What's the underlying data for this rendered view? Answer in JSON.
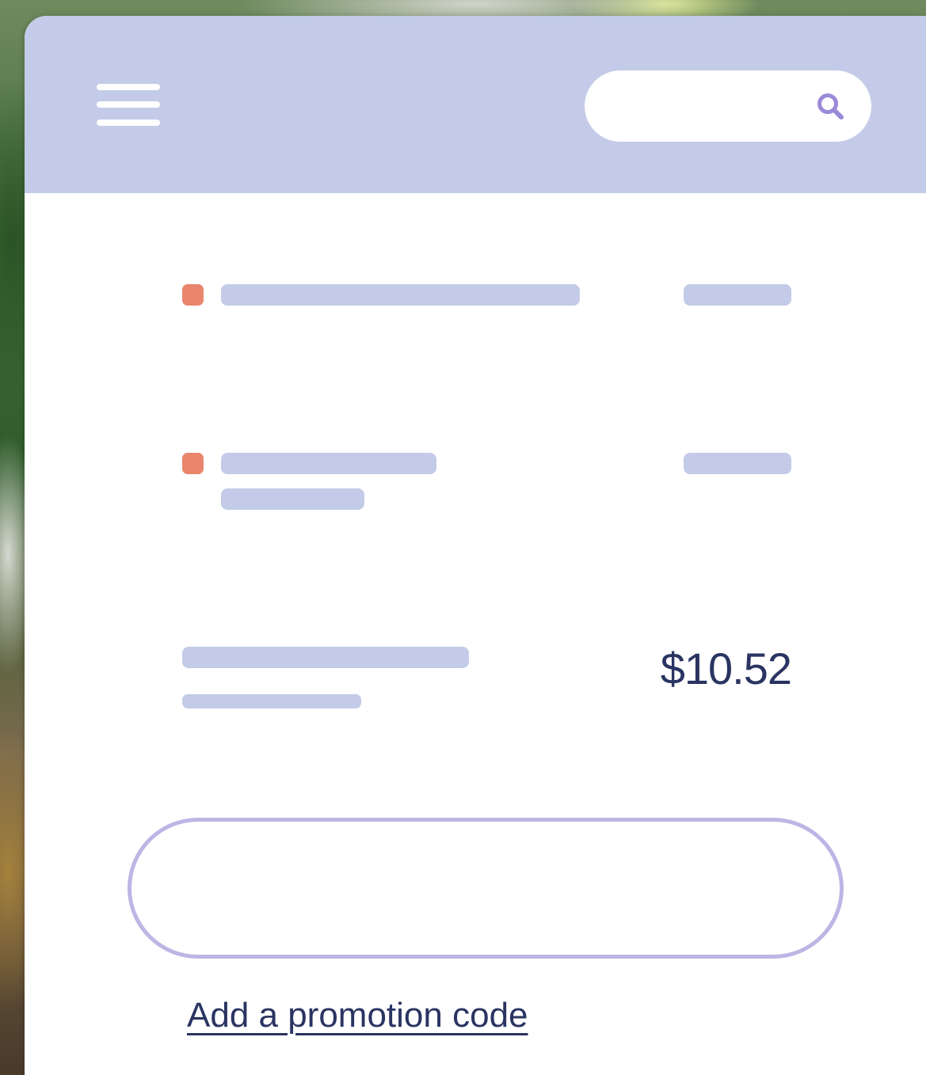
{
  "header": {
    "menu_icon": "hamburger-menu-icon",
    "search": {
      "value": "",
      "placeholder": "",
      "icon": "magnifier-icon"
    }
  },
  "order": {
    "line_items": [
      {
        "marker_color": "#e8856c",
        "lines": 1
      },
      {
        "marker_color": "#e8856c",
        "lines": 2
      }
    ],
    "total": {
      "amount": "$10.52"
    }
  },
  "promotion": {
    "input_value": "",
    "input_placeholder": "",
    "link_label": "Add a promotion code"
  },
  "colors": {
    "header_bg": "#c3cbe8",
    "placeholder_bar": "#c3cbe8",
    "marker": "#e8856c",
    "text": "#2a3462",
    "input_border": "#bcb6e5",
    "search_icon": "#9a8ad8"
  }
}
